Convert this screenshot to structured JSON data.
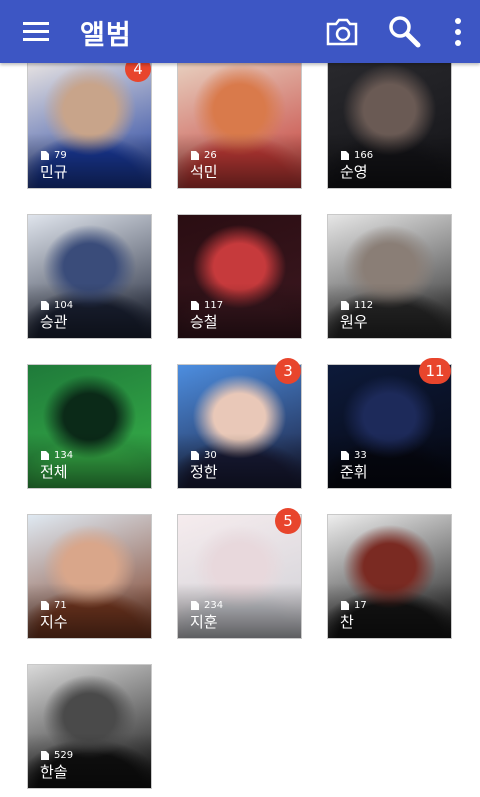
{
  "app_bar": {
    "title": "앨범",
    "background": "#3d56c4",
    "icons": [
      "menu-icon",
      "camera-icon",
      "search-icon",
      "more-vert-icon"
    ]
  },
  "albums": [
    {
      "name": "민규",
      "count": "79",
      "badge": "4",
      "colors": [
        "#f2ece6",
        "#c8a48a",
        "#1a3a9c"
      ]
    },
    {
      "name": "석민",
      "count": "26",
      "badge": "",
      "colors": [
        "#e9d7c6",
        "#d97a4b",
        "#c43b37"
      ]
    },
    {
      "name": "순영",
      "count": "166",
      "badge": "",
      "colors": [
        "#2a2a2e",
        "#6a5a54",
        "#141418"
      ]
    },
    {
      "name": "승관",
      "count": "104",
      "badge": "",
      "colors": [
        "#dfe4ec",
        "#3a4c7a",
        "#1c2336"
      ]
    },
    {
      "name": "승철",
      "count": "117",
      "badge": "",
      "colors": [
        "#2a0d12",
        "#c63a3c",
        "#3c1820"
      ]
    },
    {
      "name": "원우",
      "count": "112",
      "badge": "",
      "colors": [
        "#e6e6e6",
        "#8a7e76",
        "#2a2a2a"
      ]
    },
    {
      "name": "전체",
      "count": "134",
      "badge": "",
      "colors": [
        "#1f7a3a",
        "#0b2a18",
        "#39b54a"
      ]
    },
    {
      "name": "정한",
      "count": "30",
      "badge": "3",
      "colors": [
        "#4d8ee0",
        "#e9c8b8",
        "#1a1d3a"
      ]
    },
    {
      "name": "준휘",
      "count": "33",
      "badge": "11",
      "colors": [
        "#0d1a3a",
        "#1d2a5a",
        "#060812"
      ]
    },
    {
      "name": "지수",
      "count": "71",
      "badge": "",
      "colors": [
        "#dfe9f2",
        "#d9a68a",
        "#7a3a22"
      ]
    },
    {
      "name": "지훈",
      "count": "234",
      "badge": "5",
      "colors": [
        "#f6ecee",
        "#e8d8dc",
        "#cfd0d6"
      ]
    },
    {
      "name": "찬",
      "count": "17",
      "badge": "",
      "colors": [
        "#eeeeee",
        "#7a2a22",
        "#151515"
      ]
    },
    {
      "name": "한솔",
      "count": "529",
      "badge": "",
      "colors": [
        "#d9d9d9",
        "#4a4a4a",
        "#121212"
      ]
    }
  ]
}
